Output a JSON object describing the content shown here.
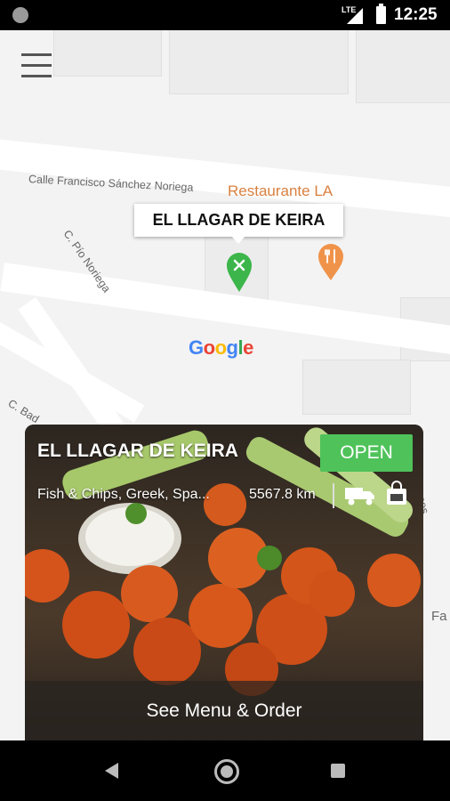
{
  "status_bar": {
    "network": "LTE",
    "time": "12:25"
  },
  "map": {
    "street_labels": [
      "Calle Francisco Sánchez Noriega",
      "C. Pío Noriega",
      "C. Bad",
      "anes",
      "Fa"
    ],
    "place_label": "Restaurante LA",
    "selected_marker_title": "EL LLAGAR DE KEIRA",
    "attribution": "Google",
    "colors": {
      "selected_marker": "#3cb54a",
      "place_marker": "#f0934a"
    }
  },
  "restaurant_card": {
    "name": "EL LLAGAR DE KEIRA",
    "status": "OPEN",
    "cuisine": "Fish & Chips, Greek, Spa...",
    "distance": "5567.8 km",
    "delivery_icon": "truck-icon",
    "pickup_icon": "shopping-bag-icon",
    "cta_label": "See Menu & Order",
    "colors": {
      "open_badge": "#4fc25a"
    }
  },
  "nav_bar": {
    "buttons": [
      "back",
      "home",
      "recents"
    ]
  }
}
